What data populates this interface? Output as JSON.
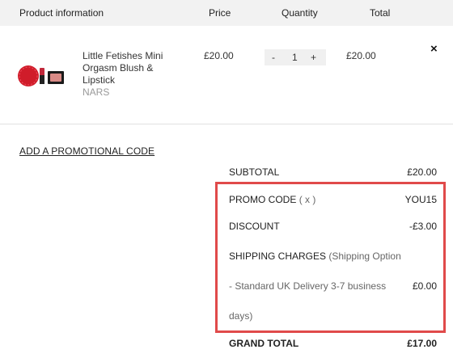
{
  "header": {
    "product": "Product information",
    "price": "Price",
    "quantity": "Quantity",
    "total": "Total"
  },
  "item": {
    "name": "Little Fetishes Mini Orgasm Blush & Lipstick",
    "brand": "NARS",
    "price": "£20.00",
    "qty_minus": "-",
    "quantity": "1",
    "qty_plus": "+",
    "total": "£20.00",
    "remove": "×",
    "thumb_logo": "NARS"
  },
  "promo_link": "ADD A PROMOTIONAL CODE",
  "summary": {
    "subtotal_label": "SUBTOTAL",
    "subtotal_value": "£20.00",
    "promo_label": "PROMO CODE",
    "promo_remove": "( x )",
    "promo_value": "YOU15",
    "discount_label": "DISCOUNT",
    "discount_value": "-£3.00",
    "shipping_label": "SHIPPING CHARGES",
    "shipping_option_1": "(Shipping Option",
    "shipping_option_2": "- Standard UK Delivery 3-7 business",
    "shipping_option_3": "days)",
    "shipping_value": "£0.00",
    "grand_total_label": "GRAND TOTAL",
    "grand_total_value": "£17.00"
  },
  "colors": {
    "header_bg": "#f2f2f2",
    "highlight_border": "#e04a4a",
    "qty_bg": "#f0f0f0",
    "brand_text": "#999999"
  }
}
